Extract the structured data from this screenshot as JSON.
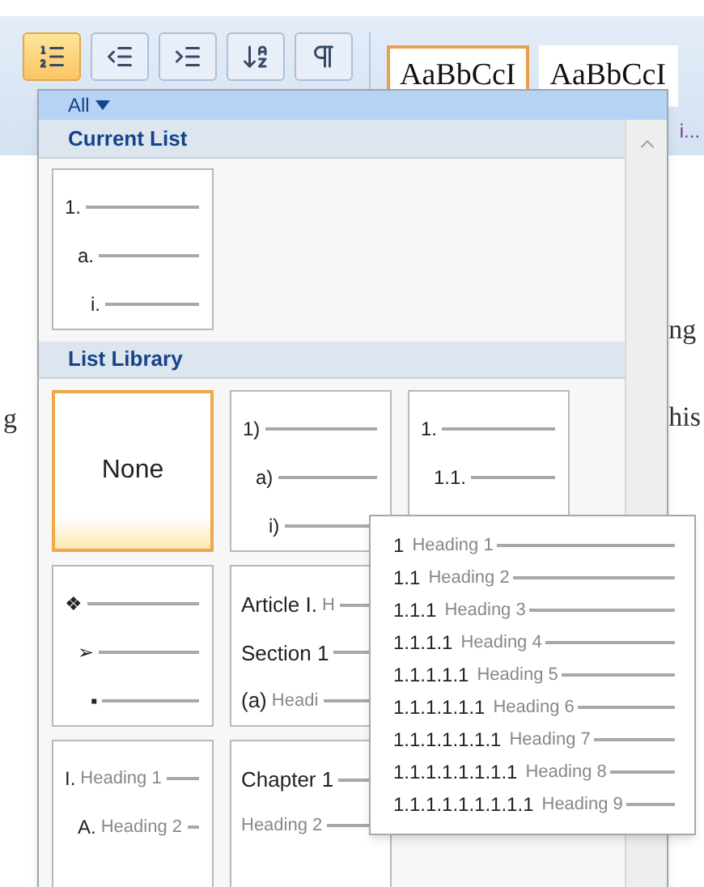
{
  "toolbar": {
    "buttons": [
      {
        "kind": "multilevel-list",
        "selected": true
      },
      {
        "kind": "decrease-indent",
        "selected": false
      },
      {
        "kind": "increase-indent",
        "selected": false
      },
      {
        "kind": "sort",
        "selected": false
      },
      {
        "kind": "pilcrow",
        "selected": false
      }
    ]
  },
  "styles": [
    {
      "preview": "AaBbCcI",
      "selected": true
    },
    {
      "preview": "AaBbCcI",
      "selected": false
    }
  ],
  "style_caption": "i...",
  "document_fragments": {
    "left": [
      "g"
    ],
    "right": [
      "ng",
      "his"
    ]
  },
  "dropdown": {
    "filter": "All",
    "current_list": {
      "title": "Current List",
      "tile": {
        "selected": false,
        "lines": [
          {
            "marker": "1."
          },
          {
            "marker": "a."
          },
          {
            "marker": "i."
          }
        ]
      }
    },
    "library": {
      "title": "List Library",
      "tiles": [
        {
          "kind": "none",
          "label": "None",
          "selected": true
        },
        {
          "kind": "lines",
          "selected": false,
          "lines": [
            {
              "marker": "1)"
            },
            {
              "marker": "a)"
            },
            {
              "marker": "i)"
            }
          ]
        },
        {
          "kind": "lines",
          "selected": false,
          "lines": [
            {
              "marker": "1."
            },
            {
              "marker": "1.1."
            }
          ]
        },
        {
          "kind": "lines",
          "selected": false,
          "lines": [
            {
              "marker": "❖"
            },
            {
              "marker": "➢"
            },
            {
              "marker": "▪"
            }
          ]
        },
        {
          "kind": "text",
          "selected": false,
          "lines": [
            {
              "marker": "Article I.",
              "label": "H"
            },
            {
              "marker": "Section 1"
            },
            {
              "marker": "(a)",
              "label": "Headi"
            }
          ]
        },
        {
          "kind": "hidden"
        },
        {
          "kind": "lines",
          "selected": false,
          "lines": [
            {
              "marker": "I.",
              "label": "Heading 1"
            },
            {
              "marker": "A.",
              "label": "Heading 2"
            }
          ]
        },
        {
          "kind": "text",
          "selected": false,
          "lines": [
            {
              "marker": "Chapter 1"
            },
            {
              "label": "Heading 2"
            }
          ]
        }
      ]
    }
  },
  "preview_popup": {
    "lines": [
      {
        "number": "1",
        "label": "Heading 1"
      },
      {
        "number": "1.1",
        "label": "Heading 2"
      },
      {
        "number": "1.1.1",
        "label": "Heading 3"
      },
      {
        "number": "1.1.1.1",
        "label": "Heading 4"
      },
      {
        "number": "1.1.1.1.1",
        "label": "Heading 5"
      },
      {
        "number": "1.1.1.1.1.1",
        "label": "Heading 6"
      },
      {
        "number": "1.1.1.1.1.1.1",
        "label": "Heading 7"
      },
      {
        "number": "1.1.1.1.1.1.1.1",
        "label": "Heading 8"
      },
      {
        "number": "1.1.1.1.1.1.1.1.1",
        "label": "Heading 9"
      }
    ]
  }
}
